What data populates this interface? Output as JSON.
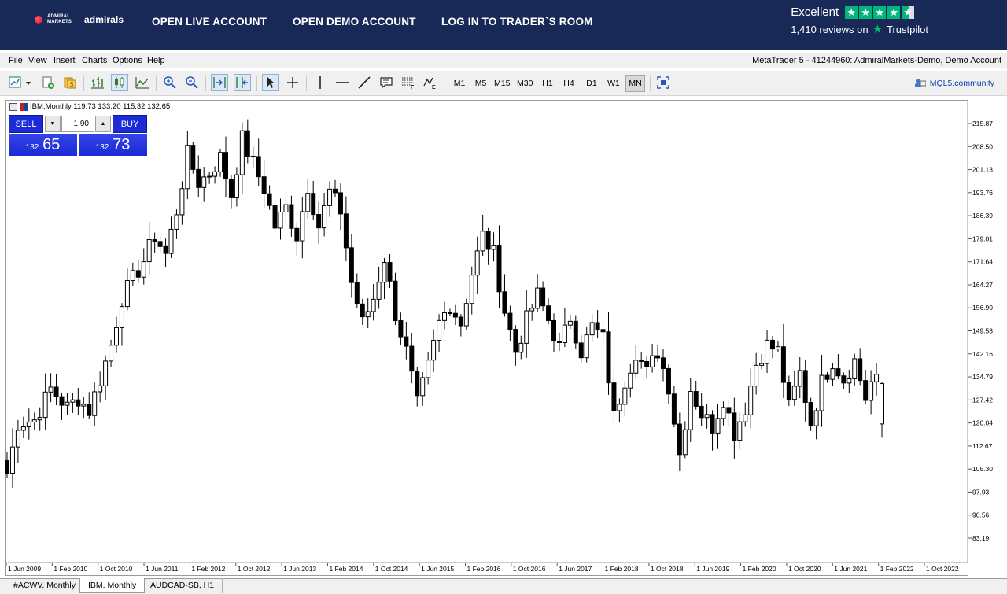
{
  "banner": {
    "logo_small": "ADMIRAL MARKETS",
    "logo_name": "admirals",
    "links": [
      "OPEN LIVE ACCOUNT",
      "OPEN DEMO ACCOUNT",
      "LOG IN TO TRADER`S ROOM"
    ],
    "rating_label": "Excellent",
    "reviews": "1,410 reviews on",
    "trustpilot": "Trustpilot",
    "star_color": "#00b67a"
  },
  "menu": {
    "items": [
      "File",
      "View",
      "Insert",
      "Charts",
      "Options",
      "Help"
    ],
    "account": "MetaTrader 5 - 41244960: AdmiralMarkets-Demo, Demo Account"
  },
  "toolbar": {
    "timeframes": [
      "M1",
      "M5",
      "M15",
      "M30",
      "H1",
      "H4",
      "D1",
      "W1",
      "MN"
    ],
    "active_timeframe": "MN",
    "community": "MQL5.community"
  },
  "chart": {
    "header": "IBM,Monthly  119.73 133.20 115.32 132.65",
    "one_click": {
      "sell_label": "SELL",
      "buy_label": "BUY",
      "volume": "1.90",
      "sell_small": "132.",
      "sell_big": "65",
      "buy_small": "132.",
      "buy_big": "73"
    }
  },
  "chart_data": {
    "type": "candlestick",
    "symbol": "IBM",
    "timeframe": "Monthly",
    "y_ticks": [
      "215.87",
      "208.50",
      "201.13",
      "193.76",
      "186.39",
      "179.01",
      "171.64",
      "164.27",
      "156.90",
      "149.53",
      "142.16",
      "134.79",
      "127.42",
      "120.04",
      "112.67",
      "105.30",
      "97.93",
      "90.56",
      "83.19"
    ],
    "x_ticks": [
      "1 Jun 2009",
      "1 Feb 2010",
      "1 Oct 2010",
      "1 Jun 2011",
      "1 Feb 2012",
      "1 Oct 2012",
      "1 Jun 2013",
      "1 Feb 2014",
      "1 Oct 2014",
      "1 Jun 2015",
      "1 Feb 2016",
      "1 Oct 2016",
      "1 Jun 2017",
      "1 Feb 2018",
      "1 Oct 2018",
      "1 Jun 2019",
      "1 Feb 2020",
      "1 Oct 2020",
      "1 Jun 2021",
      "1 Feb 2022",
      "1 Oct 2022"
    ],
    "ylim": [
      83.19,
      219.0
    ],
    "anchors": [
      [
        0,
        104
      ],
      [
        2,
        120
      ],
      [
        5,
        121
      ],
      [
        8,
        131
      ],
      [
        11,
        125
      ],
      [
        13,
        128
      ],
      [
        15,
        124
      ],
      [
        17,
        134
      ],
      [
        19,
        145
      ],
      [
        21,
        160
      ],
      [
        23,
        166
      ],
      [
        25,
        172
      ],
      [
        27,
        180
      ],
      [
        29,
        174
      ],
      [
        31,
        188
      ],
      [
        33,
        206
      ],
      [
        35,
        197
      ],
      [
        37,
        200
      ],
      [
        39,
        205
      ],
      [
        41,
        193
      ],
      [
        43,
        211
      ],
      [
        45,
        203
      ],
      [
        47,
        195
      ],
      [
        49,
        183
      ],
      [
        51,
        189
      ],
      [
        53,
        180
      ],
      [
        55,
        196
      ],
      [
        57,
        183
      ],
      [
        59,
        194
      ],
      [
        61,
        188
      ],
      [
        63,
        165
      ],
      [
        65,
        152
      ],
      [
        67,
        160
      ],
      [
        69,
        173
      ],
      [
        71,
        155
      ],
      [
        73,
        143
      ],
      [
        75,
        126
      ],
      [
        77,
        138
      ],
      [
        79,
        152
      ],
      [
        81,
        158
      ],
      [
        83,
        152
      ],
      [
        85,
        168
      ],
      [
        87,
        180
      ],
      [
        89,
        174
      ],
      [
        91,
        156
      ],
      [
        93,
        143
      ],
      [
        95,
        153
      ],
      [
        97,
        161
      ],
      [
        99,
        153
      ],
      [
        101,
        144
      ],
      [
        103,
        154
      ],
      [
        105,
        143
      ],
      [
        107,
        151
      ],
      [
        109,
        147
      ],
      [
        111,
        122
      ],
      [
        113,
        134
      ],
      [
        115,
        143
      ],
      [
        117,
        136
      ],
      [
        119,
        143
      ],
      [
        121,
        132
      ],
      [
        123,
        110
      ],
      [
        125,
        131
      ],
      [
        127,
        123
      ],
      [
        129,
        119
      ],
      [
        131,
        128
      ],
      [
        133,
        117
      ],
      [
        135,
        125
      ],
      [
        137,
        139
      ],
      [
        139,
        145
      ],
      [
        141,
        143
      ],
      [
        143,
        125
      ],
      [
        145,
        136
      ],
      [
        147,
        120
      ],
      [
        149,
        133
      ],
      [
        151,
        140
      ],
      [
        153,
        134
      ],
      [
        155,
        140
      ],
      [
        157,
        128
      ],
      [
        158,
        133
      ]
    ],
    "first_candle_open": 108,
    "last_candle": {
      "open": 119.73,
      "high": 133.2,
      "low": 115.32,
      "close": 132.65
    },
    "up_fill": "#ffffff",
    "down_fill": "#000000"
  },
  "tabs": [
    "#ACWV, Monthly",
    "IBM, Monthly",
    "AUDCAD-SB, H1"
  ],
  "active_tab": "IBM, Monthly"
}
